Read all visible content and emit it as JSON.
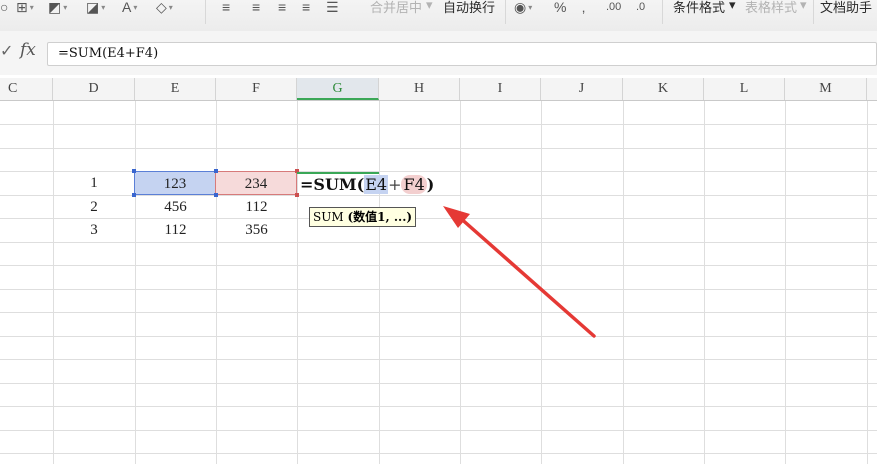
{
  "ribbon": {
    "merge_center": "合并居中",
    "wrap_text": "自动换行",
    "conditional_format": "条件格式",
    "table_style": "表格样式",
    "doc_assistant": "文档助手"
  },
  "formula_bar": {
    "fx_label": "fx",
    "formula": "=SUM(E4+F4)"
  },
  "columns": [
    "C",
    "D",
    "E",
    "F",
    "G",
    "H",
    "I",
    "J",
    "K",
    "L",
    "M"
  ],
  "active_column": "G",
  "rows": [
    {
      "d": "1",
      "e": "123",
      "f": "234"
    },
    {
      "d": "2",
      "e": "456",
      "f": "112"
    },
    {
      "d": "3",
      "e": "112",
      "f": "356"
    }
  ],
  "editing": {
    "prefix": "=SUM(",
    "ref1": "E4",
    "plus": "+",
    "ref2": "F4",
    "suffix": ")"
  },
  "tooltip": {
    "fn": "SUM",
    "args": "(数值1, ...)"
  },
  "colors": {
    "accent_green": "#3aa757",
    "ref_blue": "#5b7fd6",
    "ref_red": "#d77a7a",
    "arrow_red": "#e53935"
  }
}
